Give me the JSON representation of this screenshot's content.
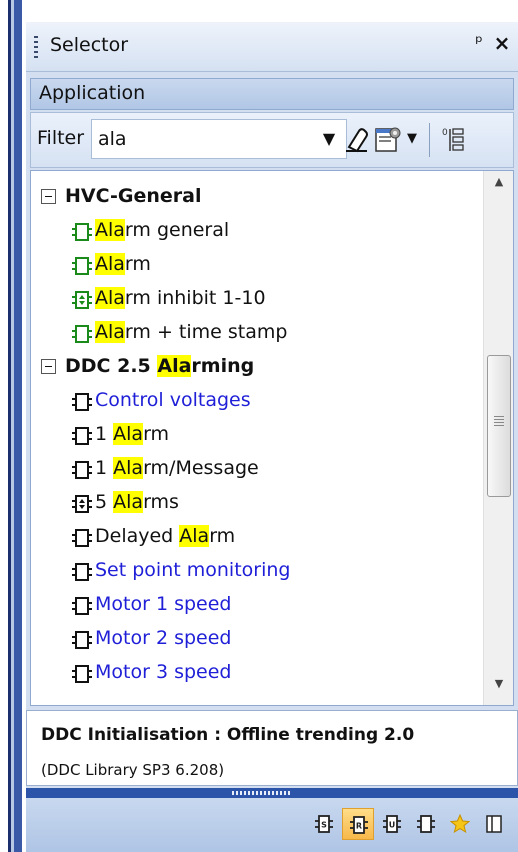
{
  "panel": {
    "title": "Selector",
    "application_label": "Application"
  },
  "filter": {
    "label": "Filter",
    "value": "ala"
  },
  "tree": {
    "groups": [
      {
        "name_parts": [
          "HVC-General"
        ],
        "expanded": true,
        "items": [
          {
            "pre": "",
            "hl": "Ala",
            "post": "rm general",
            "color": "green",
            "icon": "function-block-icon"
          },
          {
            "pre": "",
            "hl": "Ala",
            "post": "rm",
            "color": "green",
            "icon": "function-block-icon"
          },
          {
            "pre": "",
            "hl": "Ala",
            "post": "rm inhibit 1-10",
            "color": "green",
            "icon": "multi-block-icon"
          },
          {
            "pre": "",
            "hl": "Ala",
            "post": "rm + time stamp",
            "color": "green",
            "icon": "function-block-icon"
          }
        ]
      },
      {
        "name_pre": "DDC 2.5 ",
        "name_hl": "Ala",
        "name_post": "rming",
        "expanded": true,
        "items": [
          {
            "pre": "Control voltages",
            "hl": "",
            "post": "",
            "color": "blue",
            "icon": "function-block-icon"
          },
          {
            "pre": "1 ",
            "hl": "Ala",
            "post": "rm",
            "color": "black",
            "icon": "function-block-icon"
          },
          {
            "pre": "1 ",
            "hl": "Ala",
            "post": "rm/Message",
            "color": "black",
            "icon": "function-block-icon"
          },
          {
            "pre": "5 ",
            "hl": "Ala",
            "post": "rms",
            "color": "black",
            "icon": "multi-block-icon"
          },
          {
            "pre": "Delayed ",
            "hl": "Ala",
            "post": "rm",
            "color": "black",
            "icon": "function-block-icon"
          },
          {
            "pre": "Set point monitoring",
            "hl": "",
            "post": "",
            "color": "blue",
            "icon": "function-block-icon"
          },
          {
            "pre": "Motor 1 speed",
            "hl": "",
            "post": "",
            "color": "blue",
            "icon": "function-block-icon"
          },
          {
            "pre": "Motor 2 speed",
            "hl": "",
            "post": "",
            "color": "blue",
            "icon": "function-block-icon"
          },
          {
            "pre": "Motor 3 speed",
            "hl": "",
            "post": "",
            "color": "blue",
            "icon": "function-block-icon"
          }
        ]
      }
    ]
  },
  "info": {
    "title": "DDC Initialisation : Offline trending 2.0",
    "subtitle": "(DDC Library SP3 6.208)"
  },
  "colors": {
    "highlight": "#ffff00",
    "green_icon": "#1a8a1a",
    "blue_text": "#1f1fd8",
    "title_bar": "#d5e1f2",
    "splitter": "#2c54a8",
    "active_tool": "#f7b84a"
  },
  "toolbar": {
    "buttons": [
      {
        "icon": "s-block-icon",
        "active": false
      },
      {
        "icon": "r-block-icon",
        "active": true
      },
      {
        "icon": "u-block-icon",
        "active": false
      },
      {
        "icon": "plain-block-icon",
        "active": false
      },
      {
        "icon": "favorites-star-icon",
        "active": false
      },
      {
        "icon": "panel-layout-icon",
        "active": false
      }
    ]
  }
}
